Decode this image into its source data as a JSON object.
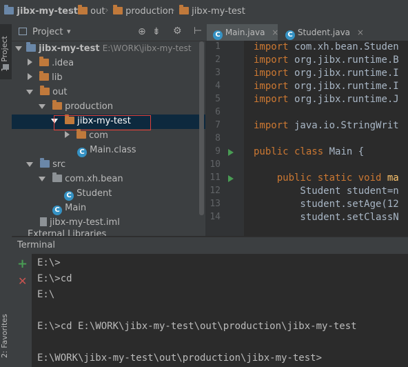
{
  "breadcrumb": {
    "items": [
      {
        "label": "jibx-my-test",
        "icon": "project-folder-icon"
      },
      {
        "label": "out",
        "icon": "folder-icon"
      },
      {
        "label": "production",
        "icon": "folder-icon"
      },
      {
        "label": "jibx-my-test",
        "icon": "folder-icon"
      }
    ]
  },
  "side_strip": {
    "project_tab": "1: Project",
    "favorites_tab": "2: Favorites"
  },
  "project_panel": {
    "title": "Project",
    "toolbar_icons": [
      "target-icon",
      "collapse-all-icon",
      "settings-gear-icon",
      "hide-panel-icon"
    ],
    "tree": [
      {
        "label": "jibx-my-test",
        "path": "E:\\WORK\\jibx-my-test",
        "expanded": true
      },
      {
        "label": ".idea",
        "expanded": false
      },
      {
        "label": "lib",
        "expanded": false
      },
      {
        "label": "out",
        "expanded": true
      },
      {
        "label": "production",
        "expanded": true
      },
      {
        "label": "jibx-my-test",
        "expanded": true,
        "selected": true
      },
      {
        "label": "com",
        "expanded": false
      },
      {
        "label": "Main.class"
      },
      {
        "label": "src",
        "expanded": true
      },
      {
        "label": "com.xh.bean",
        "expanded": true
      },
      {
        "label": "Student"
      },
      {
        "label": "Main"
      },
      {
        "label": "jibx-my-test.iml"
      },
      {
        "label": "External Libraries"
      }
    ]
  },
  "editor": {
    "tabs": [
      {
        "label": "Main.java",
        "active": true
      },
      {
        "label": "Student.java",
        "active": false
      }
    ],
    "close_glyph": "×",
    "line_numbers": [
      "1",
      "2",
      "3",
      "4",
      "5",
      "6",
      "7",
      "8",
      "9",
      "10",
      "11",
      "12",
      "13",
      "14"
    ],
    "lines": [
      {
        "kw": "import",
        "rest": " com.xh.bean.Studen"
      },
      {
        "kw": "import",
        "rest": " org.jibx.runtime.B"
      },
      {
        "kw": "import",
        "rest": " org.jibx.runtime.I"
      },
      {
        "kw": "import",
        "rest": " org.jibx.runtime.I"
      },
      {
        "kw": "import",
        "rest": " org.jibx.runtime.J"
      },
      {
        "kw": "",
        "rest": ""
      },
      {
        "kw": "import",
        "rest": " java.io.StringWrit"
      },
      {
        "kw": "",
        "rest": ""
      },
      {
        "kw": "public class",
        "rest": " Main {"
      },
      {
        "kw": "",
        "rest": ""
      },
      {
        "kw": "    public static void",
        "rest": " ma"
      },
      {
        "kw": "",
        "rest": "        Student student=n"
      },
      {
        "kw": "",
        "rest": "        student.setAge(12"
      },
      {
        "kw": "",
        "rest": "        student.setClassN"
      }
    ]
  },
  "terminal": {
    "title": "Terminal",
    "add_icon": "plus-icon",
    "close_icon": "close-icon",
    "lines": [
      "E:\\>",
      "E:\\>cd",
      "E:\\",
      "",
      "E:\\>cd E:\\WORK\\jibx-my-test\\out\\production\\jibx-my-test",
      "",
      "E:\\WORK\\jibx-my-test\\out\\production\\jibx-my-test>"
    ]
  },
  "colors": {
    "background": "#2b2b2b",
    "panel": "#3c3f41",
    "keyword": "#cc7832",
    "selection": "#0d293e",
    "highlight_box": "#e0403a",
    "folder": "#c0793b",
    "run_arrow": "#499c54"
  }
}
